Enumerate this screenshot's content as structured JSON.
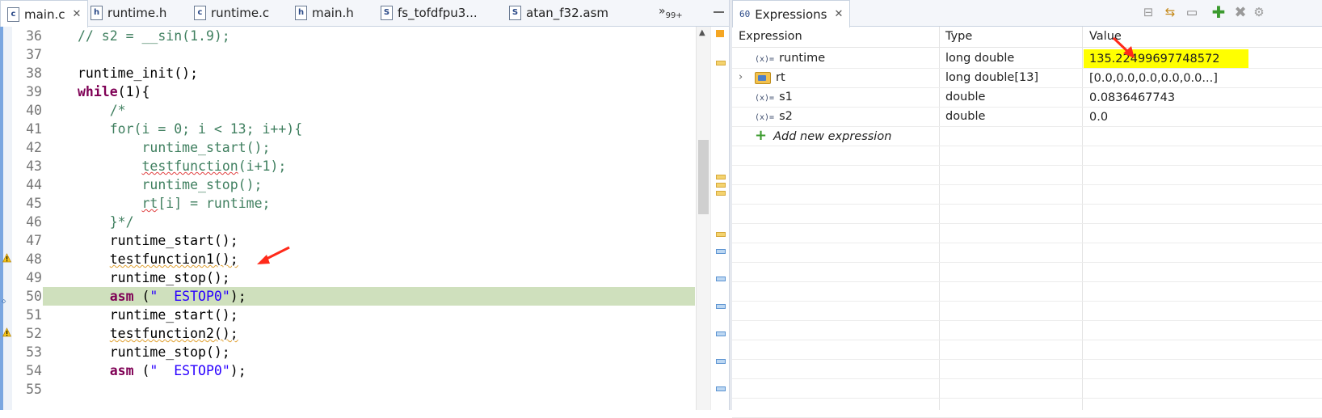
{
  "editor": {
    "tabs": [
      {
        "icon": "c",
        "label": "main.c",
        "close": "✕",
        "active": true
      },
      {
        "icon": "h",
        "label": "runtime.h"
      },
      {
        "icon": "c",
        "label": "runtime.c"
      },
      {
        "icon": "h",
        "label": "main.h"
      },
      {
        "icon": "S",
        "label": "fs_tofdfpu3..."
      },
      {
        "icon": "S",
        "label": "atan_f32.asm"
      }
    ],
    "overflow": {
      "chevron": "»",
      "count": "99+"
    },
    "lines": [
      {
        "num": "36",
        "parts": [
          [
            "cm",
            "// s2 = __sin(1.9);"
          ]
        ]
      },
      {
        "num": "37",
        "parts": []
      },
      {
        "num": "38",
        "parts": [
          [
            "pl",
            "runtime_init();"
          ]
        ]
      },
      {
        "num": "39",
        "parts": [
          [
            "kw",
            "while"
          ],
          [
            "pl",
            "(1){"
          ]
        ]
      },
      {
        "num": "40",
        "parts": [
          [
            "cm",
            "    /*"
          ]
        ]
      },
      {
        "num": "41",
        "parts": [
          [
            "cm",
            "    for(i = 0; i < 13; i++){"
          ]
        ]
      },
      {
        "num": "42",
        "parts": [
          [
            "cm",
            "        runtime_start();"
          ]
        ]
      },
      {
        "num": "43",
        "parts": [
          [
            "cm",
            "        testfunction(i+1);"
          ]
        ]
      },
      {
        "num": "44",
        "parts": [
          [
            "cm",
            "        runtime_stop();"
          ]
        ]
      },
      {
        "num": "45",
        "parts": [
          [
            "cm",
            "        rt[i] = runtime;"
          ]
        ]
      },
      {
        "num": "46",
        "parts": [
          [
            "cm",
            "    }*/"
          ]
        ]
      },
      {
        "num": "47",
        "parts": [
          [
            "pl",
            "    runtime_start();"
          ]
        ]
      },
      {
        "num": "48",
        "parts": [
          [
            "pl",
            "    testfunction1();"
          ]
        ]
      },
      {
        "num": "49",
        "parts": [
          [
            "pl",
            "    runtime_stop();"
          ]
        ]
      },
      {
        "num": "50",
        "parts": [
          [
            "kw",
            "    asm"
          ],
          [
            "pl",
            " ("
          ],
          [
            "str",
            "\"  ESTOP0\""
          ],
          [
            "pl",
            ");"
          ]
        ]
      },
      {
        "num": "51",
        "parts": [
          [
            "pl",
            "    runtime_start();"
          ]
        ]
      },
      {
        "num": "52",
        "parts": [
          [
            "pl",
            "    testfunction2();"
          ]
        ]
      },
      {
        "num": "53",
        "parts": [
          [
            "pl",
            "    runtime_stop();"
          ]
        ]
      },
      {
        "num": "54",
        "parts": [
          [
            "kw",
            "    asm"
          ],
          [
            "pl",
            " ("
          ],
          [
            "str",
            "\"  ESTOP0\""
          ],
          [
            "pl",
            ");"
          ]
        ]
      },
      {
        "num": "55",
        "parts": []
      }
    ],
    "current_line": "50",
    "warning_lines": [
      "48",
      "52"
    ]
  },
  "expressions": {
    "tab_label": "Expressions",
    "tab_close": "✕",
    "columns": {
      "expression": "Expression",
      "type": "Type",
      "value": "Value"
    },
    "rows": [
      {
        "icon": "(x)=",
        "name": "runtime",
        "type": "long double",
        "value": "135.22499697748572",
        "highlight": true
      },
      {
        "icon": "folder",
        "expand": "›",
        "name": "rt",
        "type": "long double[13]",
        "value": "[0.0,0.0,0.0,0.0,0.0...]"
      },
      {
        "icon": "(x)=",
        "name": "s1",
        "type": "double",
        "value": "0.0836467743"
      },
      {
        "icon": "(x)=",
        "name": "s2",
        "type": "double",
        "value": "0.0"
      }
    ],
    "add_new": {
      "icon": "+",
      "label": "Add new expression"
    },
    "toolbar": {
      "add": "✚",
      "remove": "✖"
    }
  },
  "colors": {
    "highlight": "#ffff00",
    "current_line": "#cfe0bd",
    "arrow": "#ff2a1a"
  }
}
